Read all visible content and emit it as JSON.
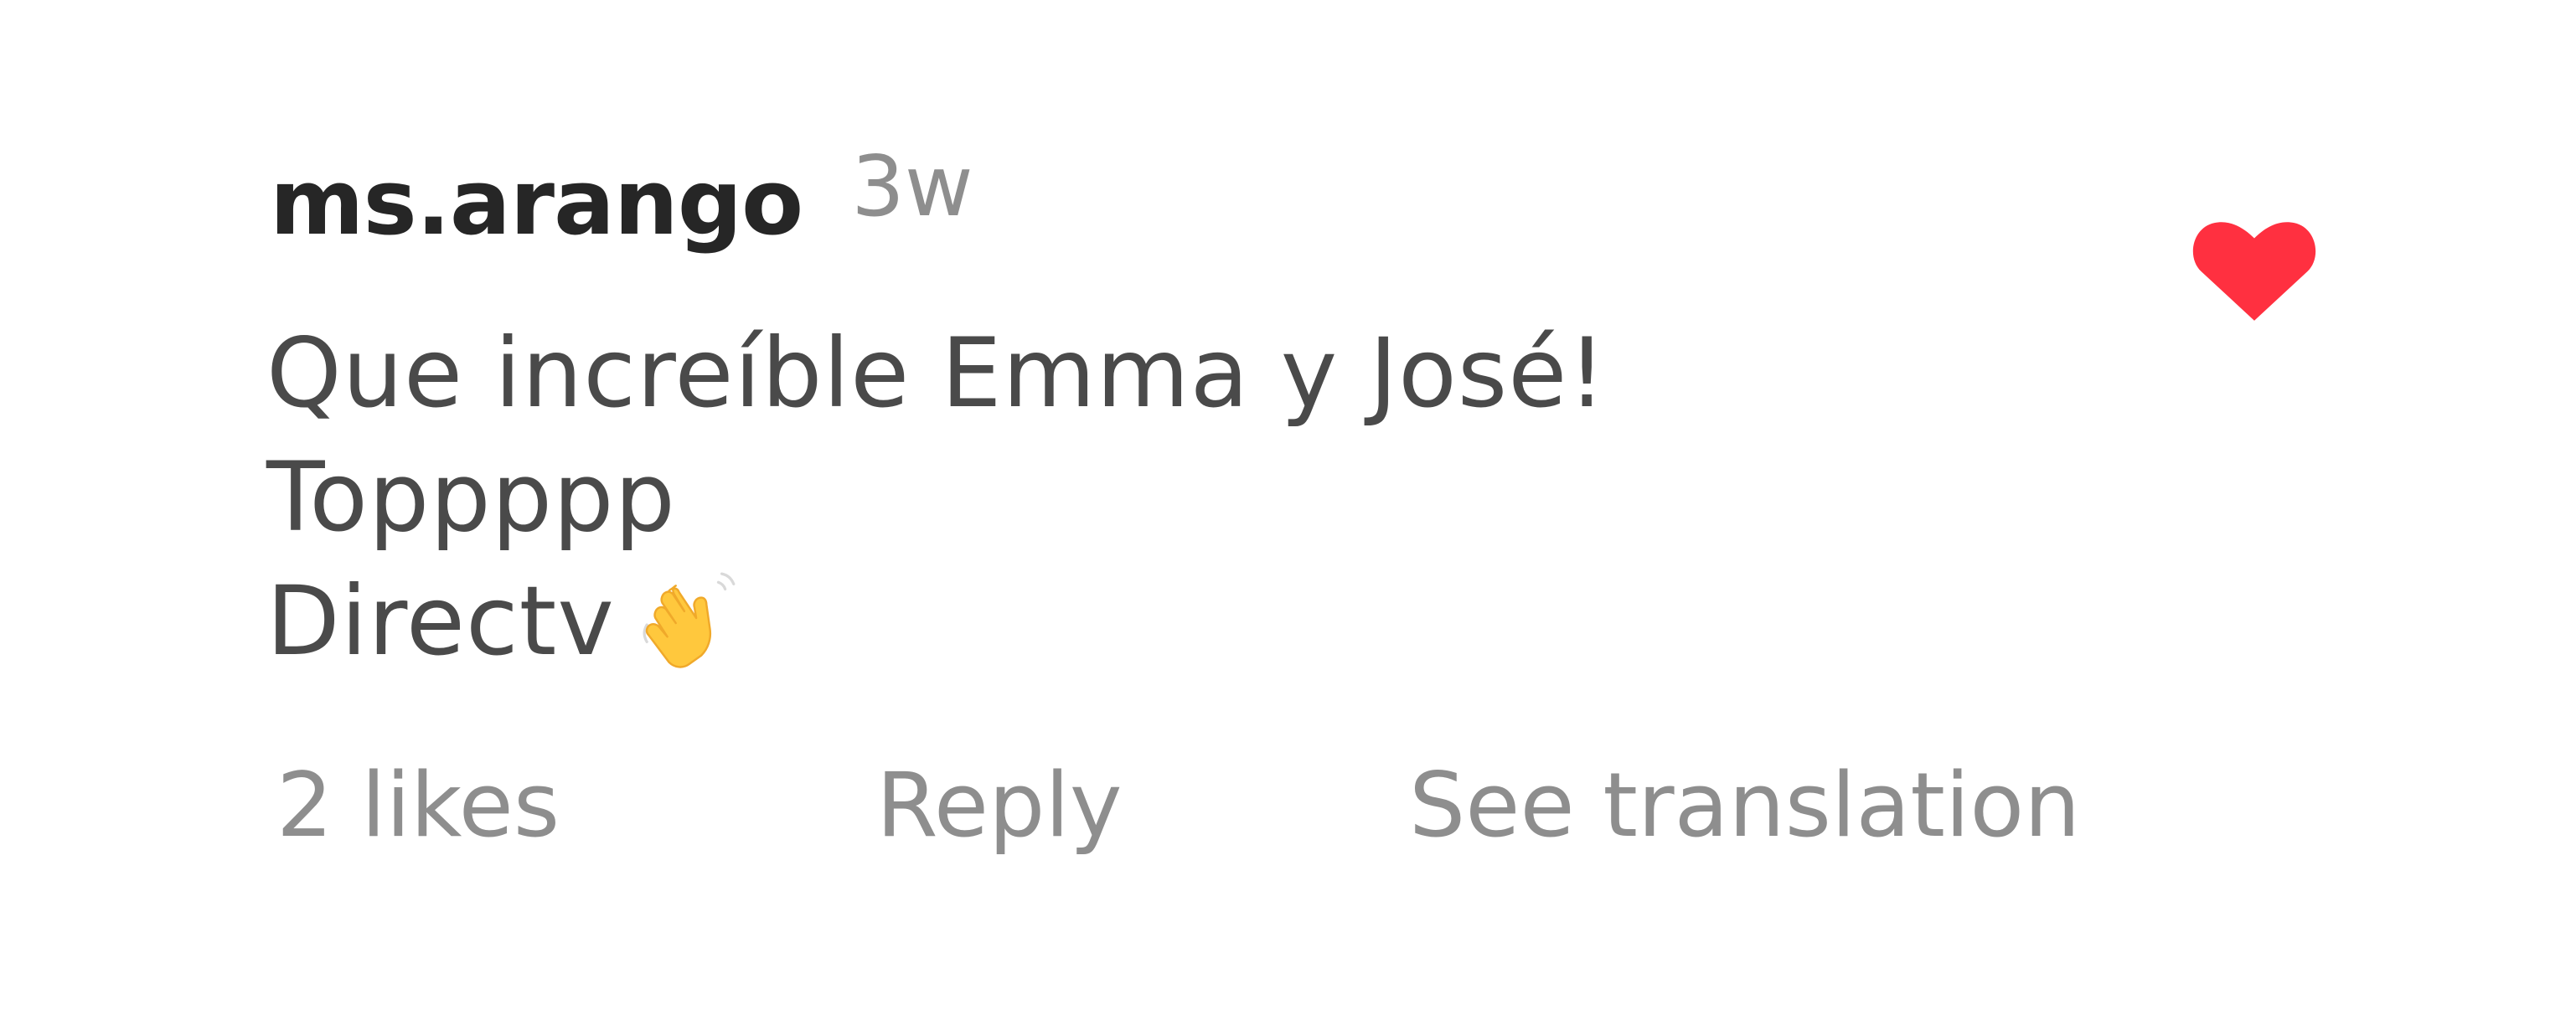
{
  "comment": {
    "username": "ms.arango",
    "timestamp": "3w",
    "lines": [
      "Que increíble Emma y José!",
      "Toppppp",
      "Directv"
    ],
    "emoji": "waving-hand",
    "liked": true
  },
  "actions": {
    "likes": "2 likes",
    "reply": "Reply",
    "see_translation": "See translation"
  },
  "colors": {
    "heart": "#ff3040",
    "username": "#262626",
    "muted": "#8e8e8e",
    "body": "#4a4a4a",
    "emoji": "#ffc83d"
  }
}
